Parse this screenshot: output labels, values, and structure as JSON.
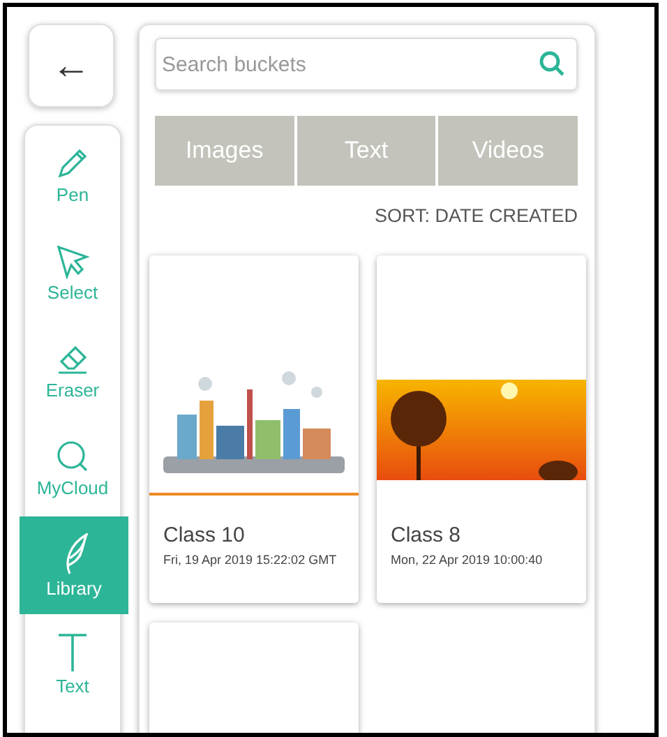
{
  "back_button": {
    "label": "←"
  },
  "tools": [
    {
      "kind": "pen",
      "label": "Pen",
      "selected": false
    },
    {
      "kind": "select",
      "label": "Select",
      "selected": false
    },
    {
      "kind": "eraser",
      "label": "Eraser",
      "selected": false
    },
    {
      "kind": "cloud",
      "label": "MyCloud",
      "selected": false
    },
    {
      "kind": "library",
      "label": "Library",
      "selected": true
    },
    {
      "kind": "text",
      "label": "Text",
      "selected": false
    }
  ],
  "search": {
    "placeholder": "Search buckets"
  },
  "tabs": [
    {
      "label": "Images",
      "selected": false
    },
    {
      "label": "Text",
      "selected": false
    },
    {
      "label": "Videos",
      "selected": false
    }
  ],
  "sort_label": "SORT: DATE CREATED",
  "cards": [
    {
      "kind": "illustration",
      "title": "Class 10",
      "date": "Fri, 19 Apr 2019 15:22:02 GMT"
    },
    {
      "kind": "photo",
      "title": "Class 8",
      "date": "Mon, 22 Apr 2019 10:00:40"
    },
    {
      "kind": "empty"
    }
  ]
}
